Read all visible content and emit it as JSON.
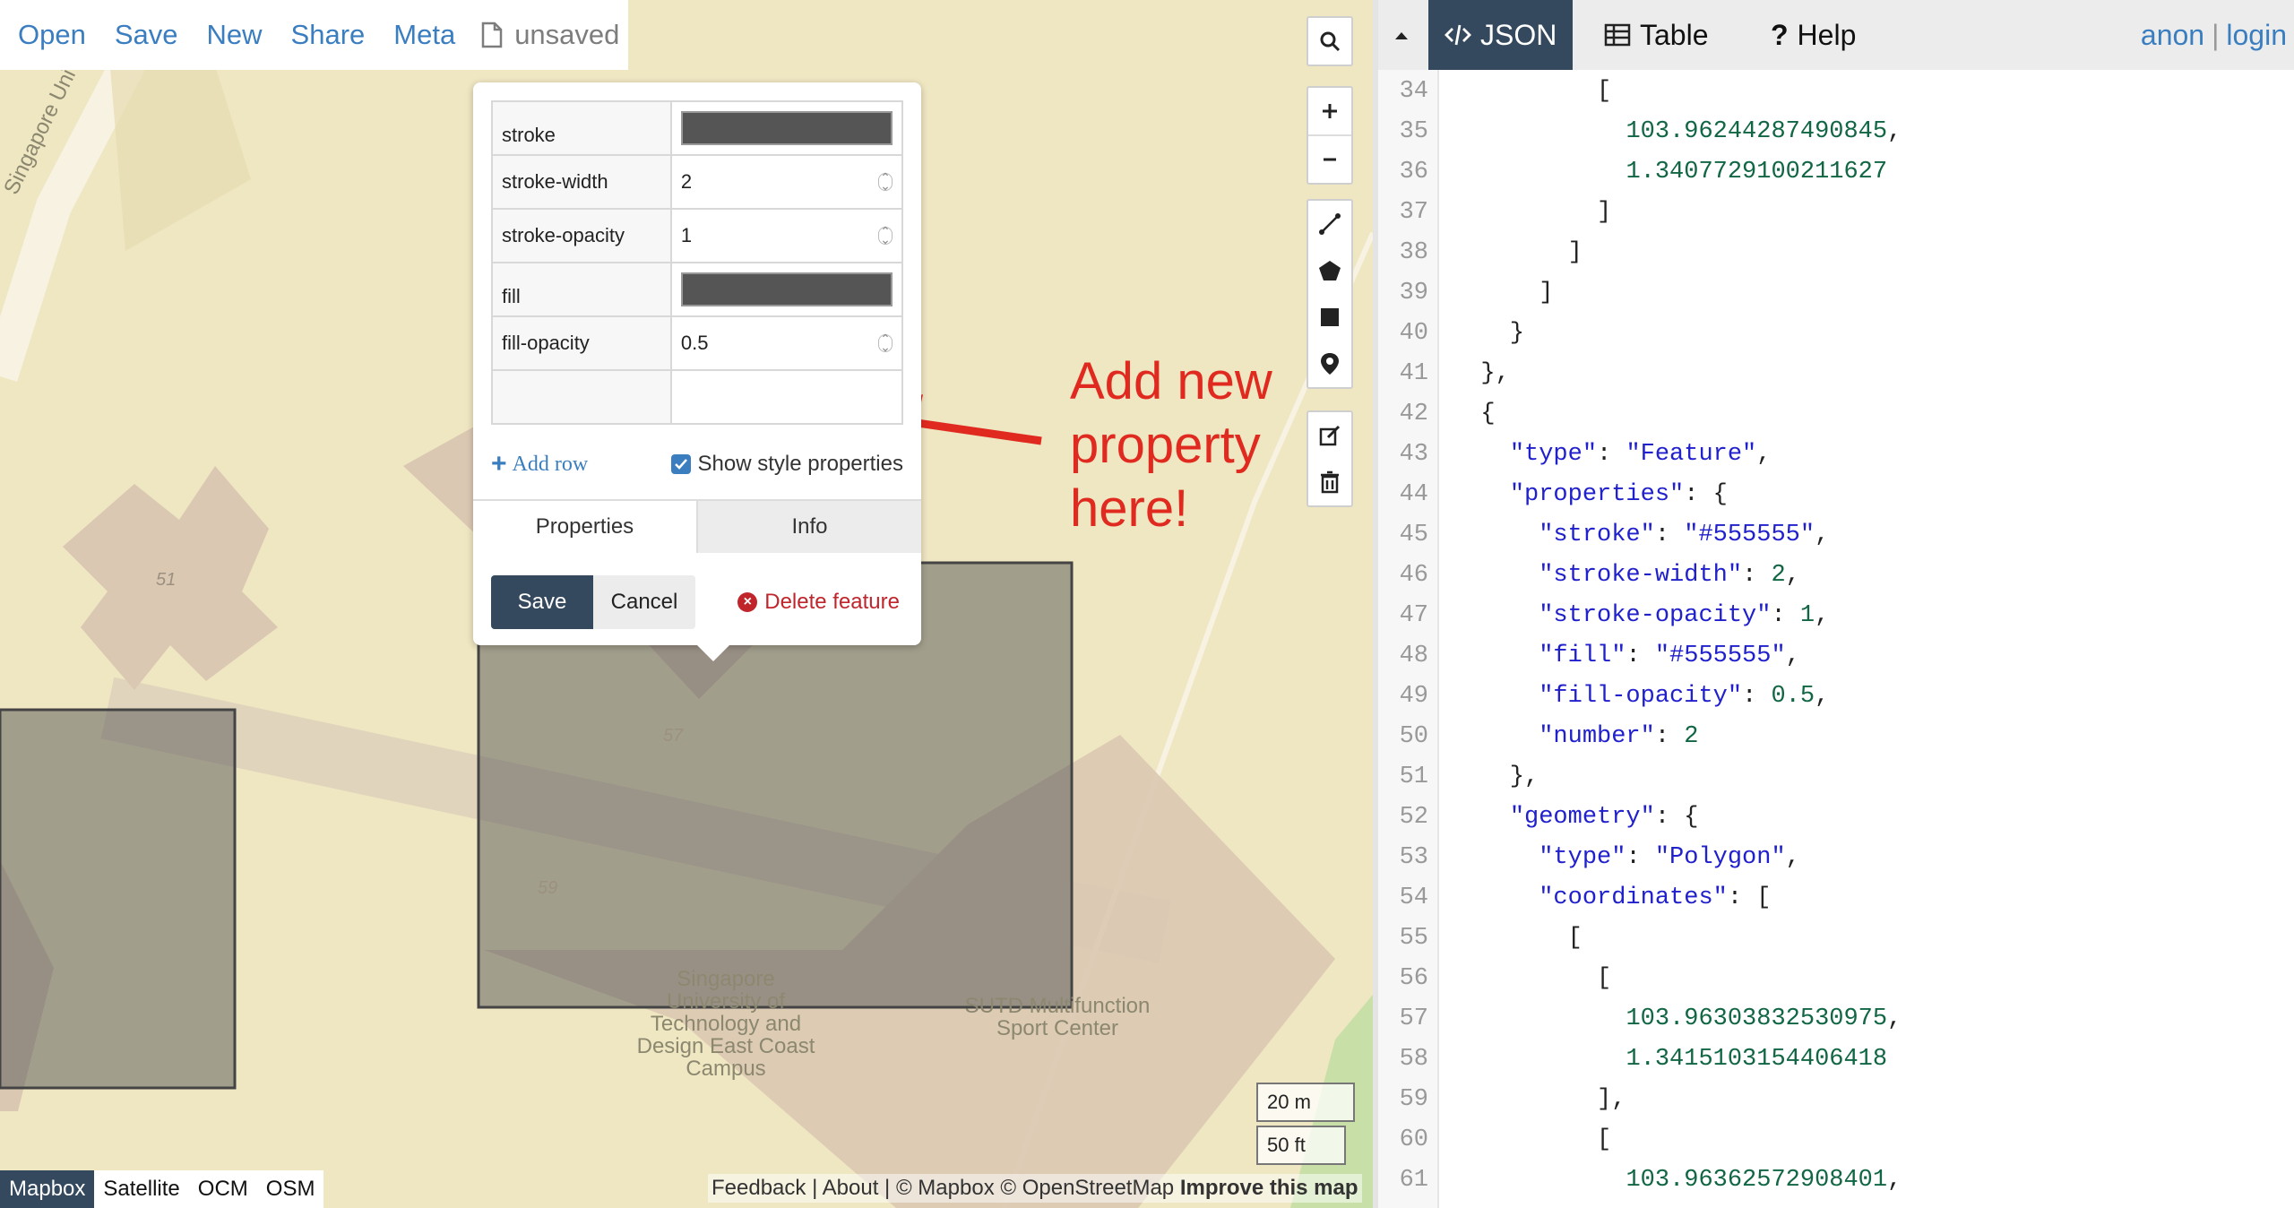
{
  "map_toolbar": {
    "open": "Open",
    "save": "Save",
    "new": "New",
    "share": "Share",
    "meta": "Meta",
    "status": "unsaved"
  },
  "map_labels": {
    "road_label": "Singapore University of Technology and Design",
    "campus_lines": [
      "Singapore",
      "University of",
      "Technology and",
      "Design East Coast",
      "Campus"
    ],
    "sport_center_lines": [
      "SUTD Multifunction",
      "Sport Center"
    ],
    "building_numbers": [
      "51",
      "57",
      "59"
    ]
  },
  "popup": {
    "properties": [
      {
        "key": "stroke",
        "value": "#555555",
        "type": "color"
      },
      {
        "key": "stroke-width",
        "value": "2",
        "type": "number"
      },
      {
        "key": "stroke-opacity",
        "value": "1",
        "type": "number"
      },
      {
        "key": "fill",
        "value": "#555555",
        "type": "color"
      },
      {
        "key": "fill-opacity",
        "value": "0.5",
        "type": "number"
      },
      {
        "key": "",
        "value": "",
        "type": "empty"
      }
    ],
    "add_row": "Add row",
    "show_style": "Show style properties",
    "tab_properties": "Properties",
    "tab_info": "Info",
    "save": "Save",
    "cancel": "Cancel",
    "delete": "Delete feature"
  },
  "annotation": {
    "lines": [
      "Add new",
      "property",
      "here!"
    ],
    "color": "#e02a20"
  },
  "layers": [
    "Mapbox",
    "Satellite",
    "OCM",
    "OSM"
  ],
  "attribution": {
    "feedback": "Feedback",
    "about": "About",
    "mapbox": "© Mapbox",
    "osm": "© OpenStreetMap",
    "improve": "Improve this map"
  },
  "scale": {
    "metric": "20 m",
    "imperial": "50 ft"
  },
  "panel": {
    "tabs": [
      "JSON",
      "Table",
      "Help"
    ],
    "user": "anon",
    "login": "login"
  },
  "code_lines": [
    {
      "n": 34,
      "t": "          ["
    },
    {
      "n": 35,
      "t": "            103.96244287490845,"
    },
    {
      "n": 36,
      "t": "            1.3407729100211627"
    },
    {
      "n": 37,
      "t": "          ]"
    },
    {
      "n": 38,
      "t": "        ]"
    },
    {
      "n": 39,
      "t": "      ]"
    },
    {
      "n": 40,
      "t": "    }"
    },
    {
      "n": 41,
      "t": "  },"
    },
    {
      "n": 42,
      "t": "  {"
    },
    {
      "n": 43,
      "t": "    \"type\": \"Feature\","
    },
    {
      "n": 44,
      "t": "    \"properties\": {"
    },
    {
      "n": 45,
      "t": "      \"stroke\": \"#555555\","
    },
    {
      "n": 46,
      "t": "      \"stroke-width\": 2,"
    },
    {
      "n": 47,
      "t": "      \"stroke-opacity\": 1,"
    },
    {
      "n": 48,
      "t": "      \"fill\": \"#555555\","
    },
    {
      "n": 49,
      "t": "      \"fill-opacity\": 0.5,"
    },
    {
      "n": 50,
      "t": "      \"number\": 2"
    },
    {
      "n": 51,
      "t": "    },"
    },
    {
      "n": 52,
      "t": "    \"geometry\": {"
    },
    {
      "n": 53,
      "t": "      \"type\": \"Polygon\","
    },
    {
      "n": 54,
      "t": "      \"coordinates\": ["
    },
    {
      "n": 55,
      "t": "        ["
    },
    {
      "n": 56,
      "t": "          ["
    },
    {
      "n": 57,
      "t": "            103.96303832530975,"
    },
    {
      "n": 58,
      "t": "            1.3415103154406418"
    },
    {
      "n": 59,
      "t": "          ],"
    },
    {
      "n": 60,
      "t": "          ["
    },
    {
      "n": 61,
      "t": "            103.96362572908401,"
    }
  ],
  "colors": {
    "accent": "#3a7ec0",
    "dark": "#34495e",
    "danger": "#c0252c",
    "map_bg": "#efe6c2",
    "polygon_fill": "#555555"
  }
}
